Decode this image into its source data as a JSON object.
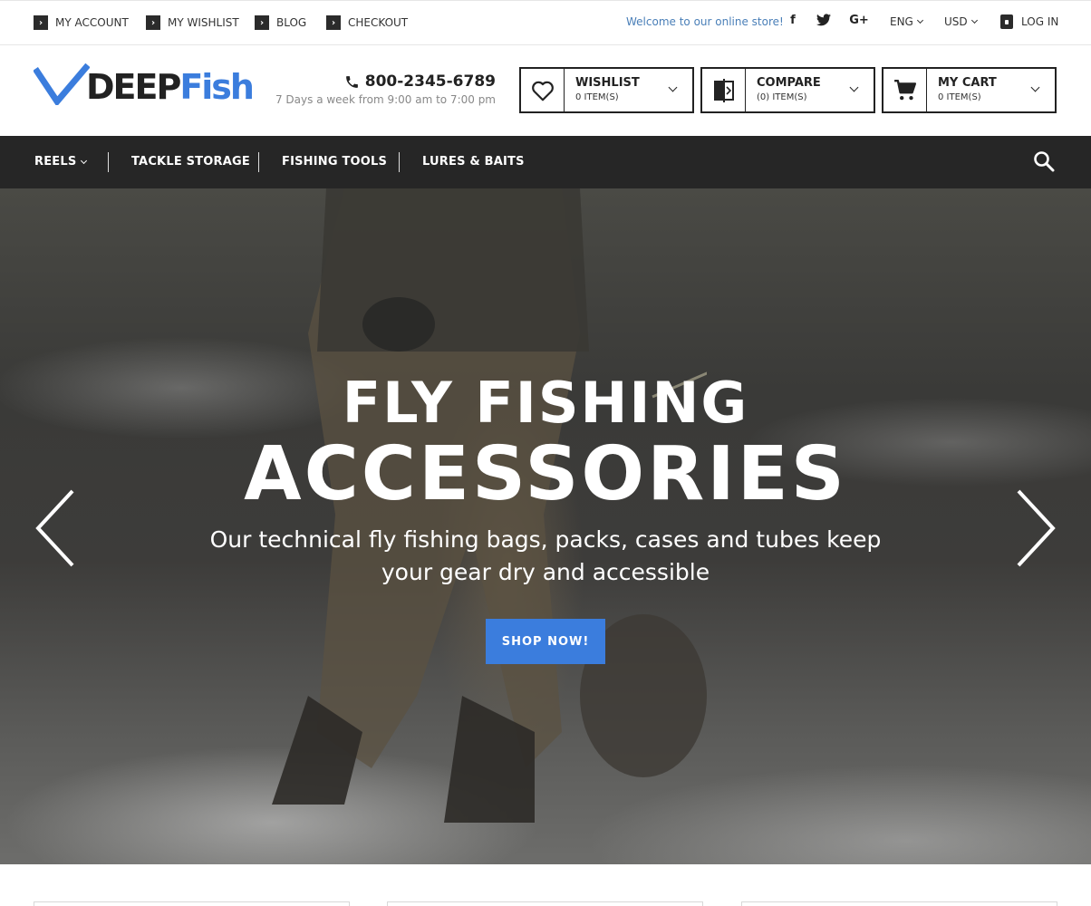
{
  "topbar": {
    "links": [
      "MY ACCOUNT",
      "MY WISHLIST",
      "BLOG",
      "CHECKOUT"
    ],
    "welcome": "Welcome to our online store!",
    "social": [
      "f",
      "t",
      "G+"
    ],
    "language": "ENG",
    "currency": "USD",
    "login": "LOG IN"
  },
  "logo": {
    "part1": "DEEP",
    "part2": "Fish"
  },
  "contact": {
    "phone": "800-2345-6789",
    "hours": "7 Days a week from 9:00 am to 7:00 pm"
  },
  "header_boxes": {
    "wishlist": {
      "title": "WISHLIST",
      "count": "0 ITEM(S)"
    },
    "compare": {
      "title": "COMPARE",
      "count": "(0) ITEM(S)"
    },
    "cart": {
      "title": "MY CART",
      "count": "0 ITEM(S)"
    }
  },
  "nav": {
    "items": [
      "REELS",
      "TACKLE STORAGE",
      "FISHING TOOLS",
      "LURES & BAITS"
    ]
  },
  "hero": {
    "line1": "FLY FISHING",
    "line2": "ACCESSORIES",
    "sub1": "Our technical fly fishing bags, packs, cases and tubes keep",
    "sub2": "your gear dry and accessible",
    "button": "SHOP NOW!"
  },
  "colors": {
    "accent": "#3b7ddd",
    "nav_bg": "#262626",
    "welcome": "#4a7fb8"
  }
}
